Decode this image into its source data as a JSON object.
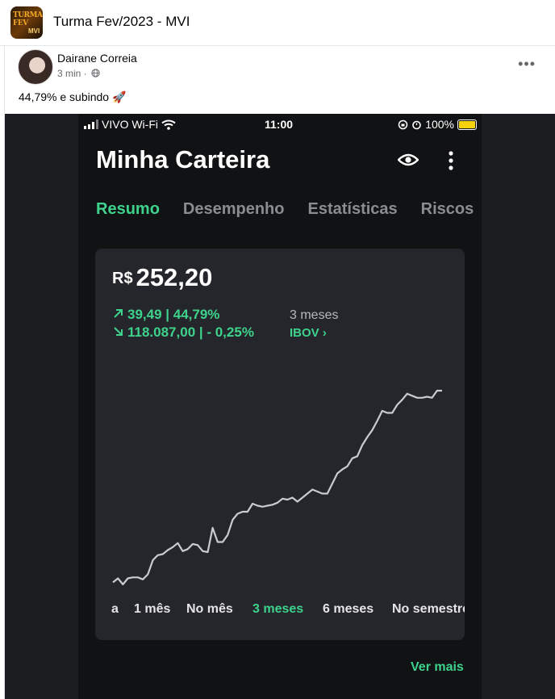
{
  "group": {
    "name": "Turma Fev/2023 - MVI",
    "avatar_text": "TURMA FEV",
    "avatar_badge": "MVI"
  },
  "post": {
    "author": "Dairane Correia",
    "time": "3 min ·",
    "privacy_icon": "globe-icon",
    "more_label": "•••",
    "text": "44,79% e subindo 🚀"
  },
  "phone": {
    "status": {
      "carrier": "VIVO Wi-Fi",
      "time": "11:00",
      "battery": "100%"
    },
    "title": "Minha Carteira",
    "tabs": [
      {
        "label": "Resumo",
        "active": true
      },
      {
        "label": "Desempenho",
        "active": false
      },
      {
        "label": "Estatísticas",
        "active": false
      },
      {
        "label": "Riscos",
        "active": false
      }
    ],
    "card": {
      "currency": "R$",
      "balance": "252,20",
      "portfolio_change": "39,49 | 44,79%",
      "period": "3 meses",
      "ibov_change": "118.087,00 | - 0,25%",
      "ibov_link": "IBOV ›",
      "ranges": [
        {
          "label": "a",
          "active": false
        },
        {
          "label": "1 mês",
          "active": false
        },
        {
          "label": "No mês",
          "active": false
        },
        {
          "label": "3 meses",
          "active": true
        },
        {
          "label": "6 meses",
          "active": false
        },
        {
          "label": "No semestre",
          "active": false
        }
      ]
    },
    "ver_mais": "Ver mais",
    "colors": {
      "accent": "#3ed38c",
      "card": "#25262b",
      "background": "#111214",
      "line": "#c9cbd4"
    }
  },
  "chart_data": {
    "type": "line",
    "series": [
      {
        "values": [
          0,
          4,
          -2,
          4,
          5,
          5,
          3,
          8,
          22,
          27,
          28,
          32,
          35,
          39,
          31,
          33,
          38,
          37,
          31,
          30,
          54,
          40,
          40,
          47,
          62,
          68,
          70,
          70,
          78,
          76,
          75,
          76,
          77,
          79,
          83,
          82,
          84,
          80,
          84,
          88,
          92,
          90,
          88,
          88,
          98,
          108,
          112,
          115,
          123,
          125,
          136,
          144,
          151,
          160,
          170,
          168,
          168,
          176,
          181,
          187,
          185,
          183,
          183,
          184,
          183,
          190,
          190
        ]
      }
    ]
  }
}
